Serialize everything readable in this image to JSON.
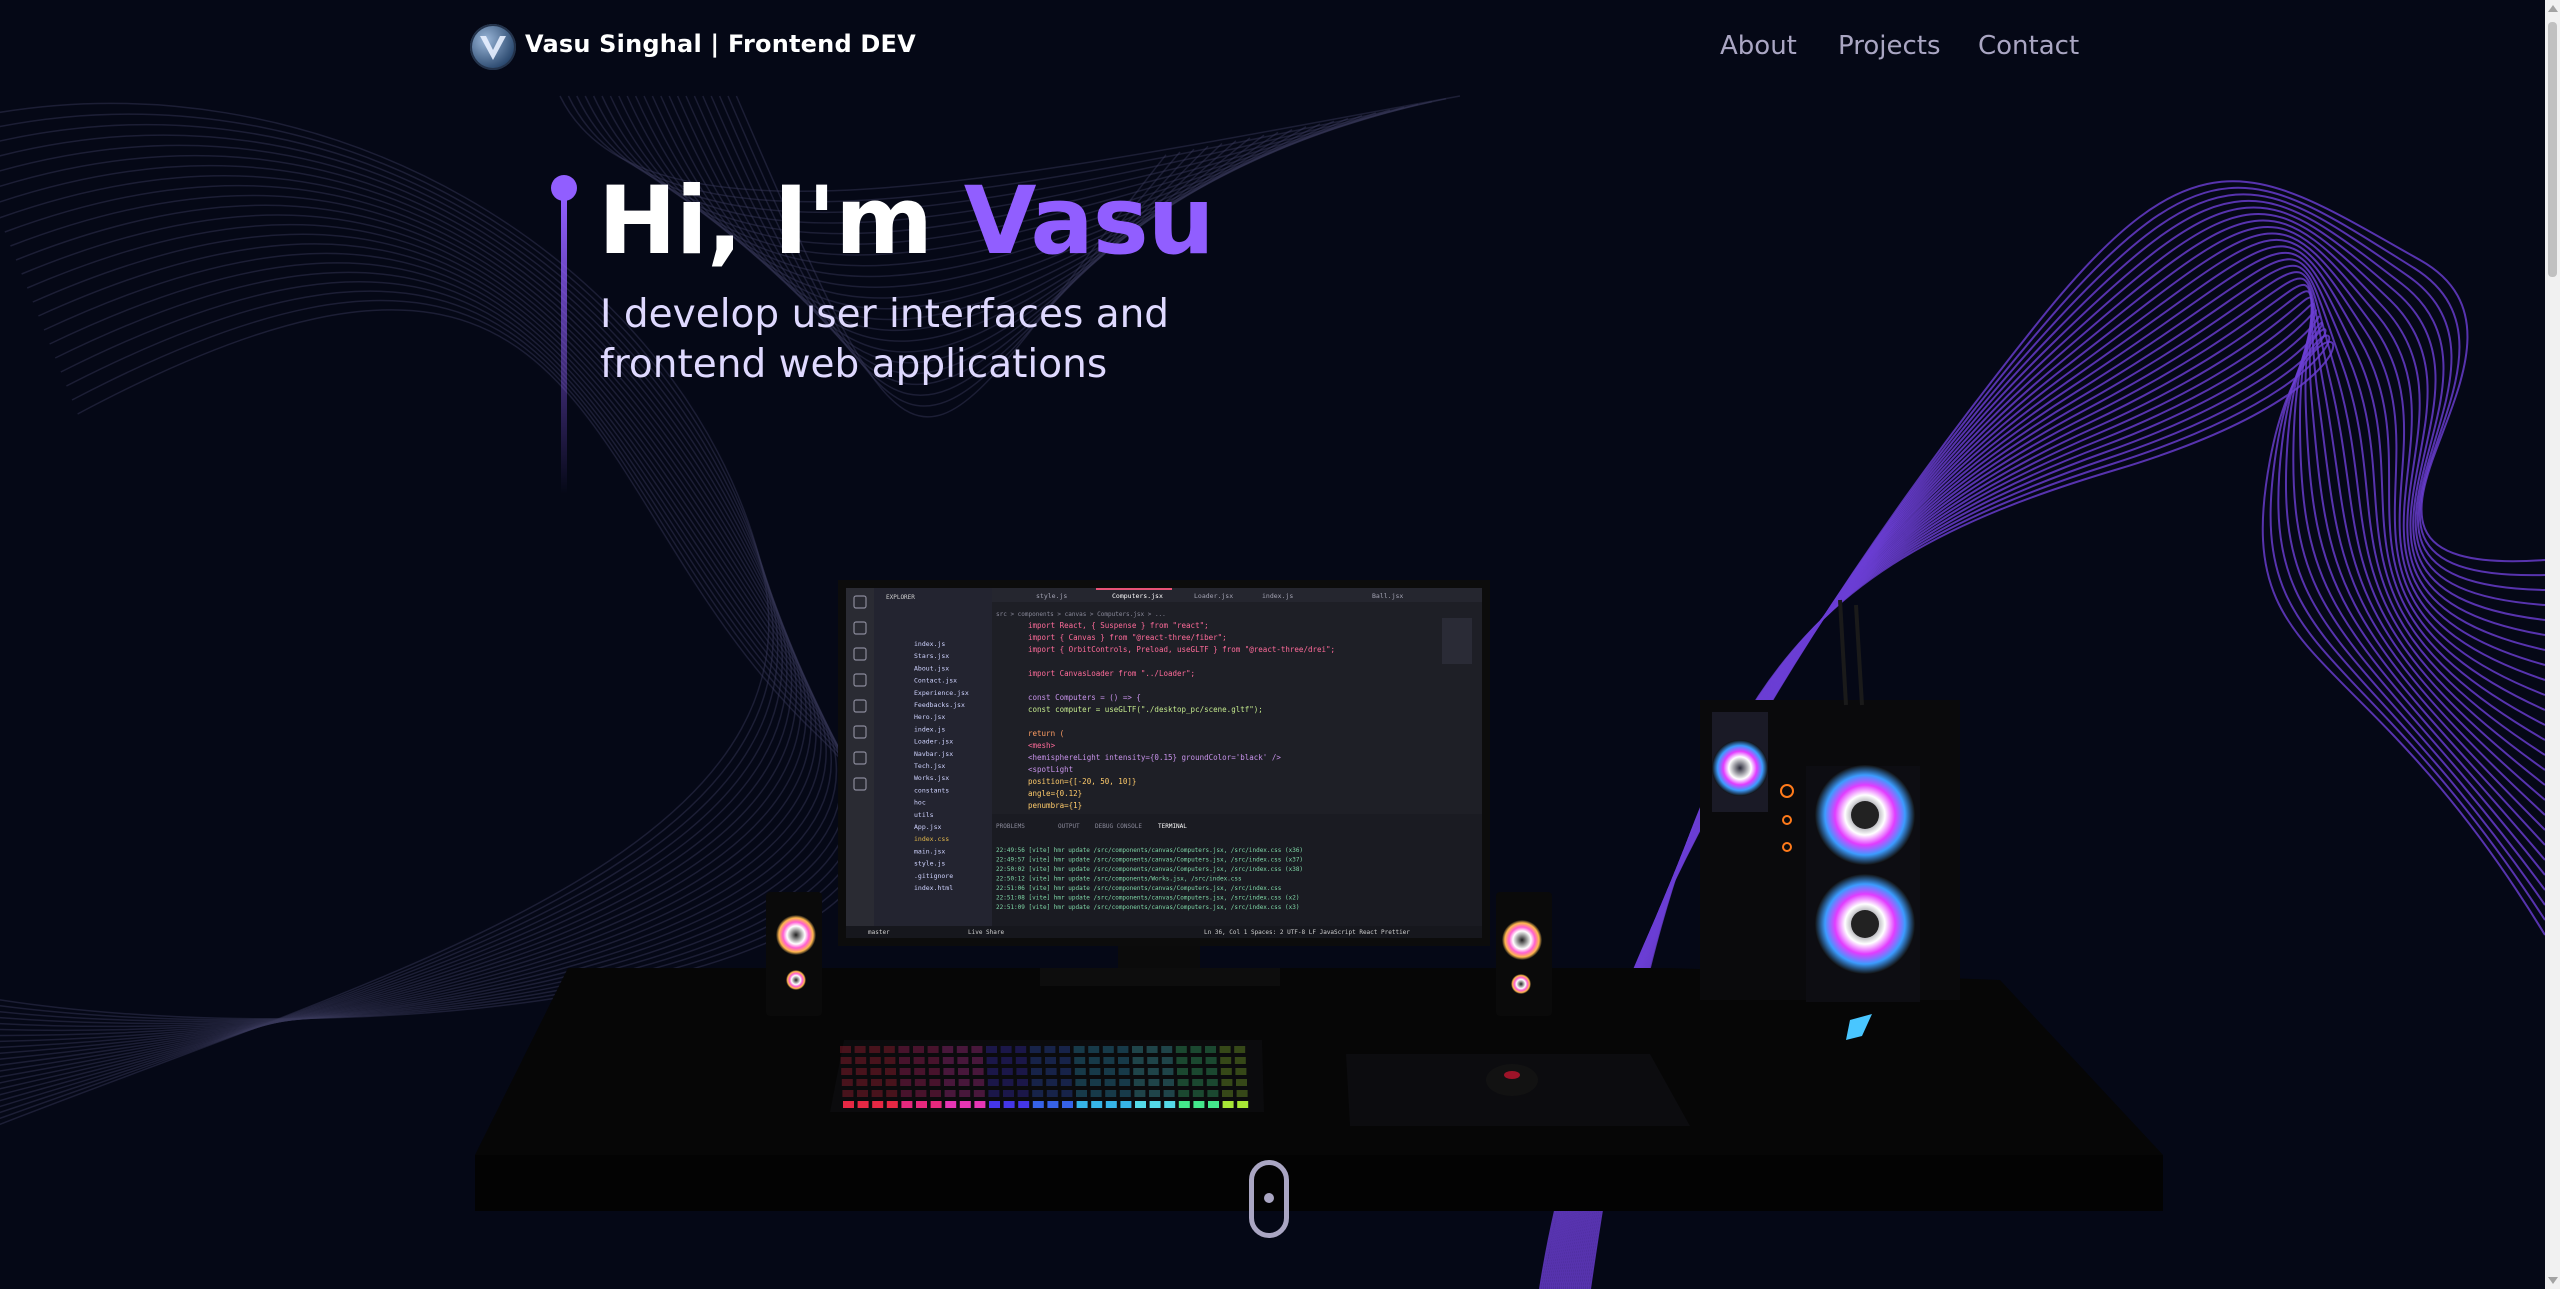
{
  "nav": {
    "brand": "Vasu Singhal | Frontend DEV",
    "links": [
      "About",
      "Projects",
      "Contact"
    ]
  },
  "hero": {
    "greeting": "Hi, I'm ",
    "name": "Vasu",
    "subtitle_line1": "I develop user interfaces and",
    "subtitle_line2": "frontend web applications"
  },
  "editor": {
    "tabs": [
      "style.js",
      "Computers.jsx",
      "Loader.jsx",
      "index.js",
      "Ball.jsx"
    ],
    "breadcrumb": "src > components > canvas > Computers.jsx > ...",
    "explorer_title": "EXPLORER",
    "files": [
      "index.js",
      "Stars.jsx",
      "About.jsx",
      "Contact.jsx",
      "Experience.jsx",
      "Feedbacks.jsx",
      "Hero.jsx",
      "index.js",
      "Loader.jsx",
      "Navbar.jsx",
      "Tech.jsx",
      "Works.jsx",
      "constants",
      "hoc",
      "utils",
      "App.jsx",
      "index.css",
      "main.jsx",
      "style.js",
      ".gitignore",
      "index.html"
    ],
    "code_lines": [
      "import React, { Suspense } from \"react\";",
      "import { Canvas } from \"@react-three/fiber\";",
      "import { OrbitControls, Preload, useGLTF } from \"@react-three/drei\";",
      "",
      "import CanvasLoader from \"../Loader\";",
      "",
      "const Computers = () => {",
      "  const computer = useGLTF(\"./desktop_pc/scene.gltf\");",
      "",
      "  return (",
      "    <mesh>",
      "      <hemisphereLight intensity={0.15} groundColor='black' />",
      "      <spotLight",
      "        position={[-20, 50, 10]}",
      "        angle={0.12}",
      "        penumbra={1}"
    ],
    "panel_tabs": [
      "PROBLEMS",
      "OUTPUT",
      "DEBUG CONSOLE",
      "TERMINAL"
    ],
    "terminal_lines": [
      "22:49:56 [vite] hmr update /src/components/canvas/Computers.jsx, /src/index.css (x36)",
      "22:49:57 [vite] hmr update /src/components/canvas/Computers.jsx, /src/index.css (x37)",
      "22:50:02 [vite] hmr update /src/components/canvas/Computers.jsx, /src/index.css (x38)",
      "22:50:12 [vite] hmr update /src/components/Works.jsx, /src/index.css",
      "22:51:06 [vite] hmr update /src/components/canvas/Computers.jsx, /src/index.css",
      "22:51:08 [vite] hmr update /src/components/canvas/Computers.jsx, /src/index.css (x2)",
      "22:51:09 [vite] hmr update /src/components/canvas/Computers.jsx, /src/index.css (x3)"
    ],
    "status_left": "master",
    "status_live": "Live Share",
    "status_right": "Ln 36, Col 1   Spaces: 2   UTF-8   LF   JavaScript React   Prettier"
  },
  "colors": {
    "background": "#050816",
    "accent": "#915eff",
    "nav_text": "#aaa6c3",
    "subtitle": "#dfd9ff"
  },
  "icons": {
    "logo": "v-logo-icon",
    "scroll": "mouse-scroll-icon"
  }
}
